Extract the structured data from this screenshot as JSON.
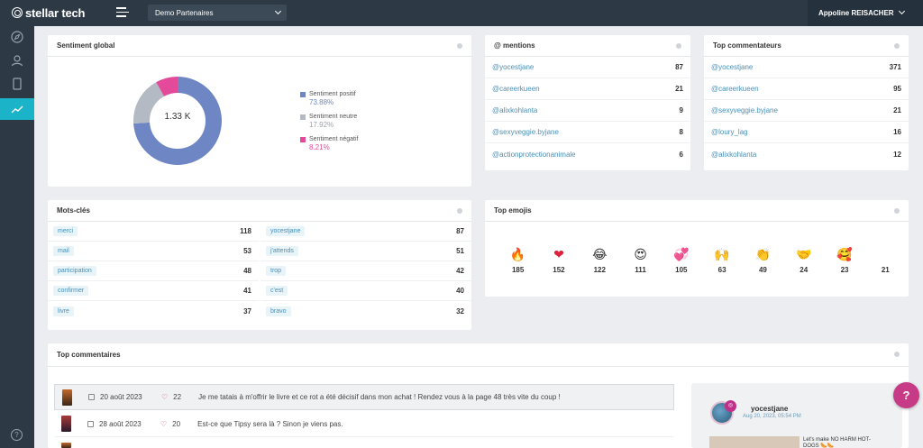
{
  "header": {
    "brand": "stellar tech",
    "project_select": "Demo Partenaires",
    "user_name": "Appoline REISACHER"
  },
  "sidebar": {
    "items": [
      {
        "icon": "compass-icon"
      },
      {
        "icon": "user-icon"
      },
      {
        "icon": "tablet-icon"
      },
      {
        "icon": "trend-icon",
        "active": true
      }
    ],
    "help": "?"
  },
  "sentiment": {
    "title": "Sentiment global",
    "total": "1.33 K",
    "items": [
      {
        "label": "Sentiment positif",
        "value": "73.88%",
        "color": "#6f86c4",
        "fraction": 0.7388
      },
      {
        "label": "Sentiment neutre",
        "value": "17.92%",
        "color": "#b3bac4",
        "fraction": 0.1792
      },
      {
        "label": "Sentiment négatif",
        "value": "8.21%",
        "color": "#e44a9a",
        "fraction": 0.0821
      }
    ]
  },
  "mentions": {
    "title": "@ mentions",
    "rows": [
      {
        "label": "@yocestjane",
        "value": "87"
      },
      {
        "label": "@careerkueen",
        "value": "21"
      },
      {
        "label": "@alixkohlanta",
        "value": "9"
      },
      {
        "label": "@sexyveggie.byjane",
        "value": "8"
      },
      {
        "label": "@actionprotectionanimale",
        "value": "6"
      }
    ]
  },
  "commentateurs": {
    "title": "Top commentateurs",
    "rows": [
      {
        "label": "@yocestjane",
        "value": "371"
      },
      {
        "label": "@careerkueen",
        "value": "95"
      },
      {
        "label": "@sexyveggie.byjane",
        "value": "21"
      },
      {
        "label": "@loury_lag",
        "value": "16"
      },
      {
        "label": "@alixkohlanta",
        "value": "12"
      }
    ]
  },
  "keywords": {
    "title": "Mots-clés",
    "left": [
      {
        "label": "merci",
        "value": "118"
      },
      {
        "label": "mail",
        "value": "53"
      },
      {
        "label": "participation",
        "value": "48"
      },
      {
        "label": "confirmer",
        "value": "41"
      },
      {
        "label": "livre",
        "value": "37"
      }
    ],
    "right": [
      {
        "label": "yocestjane",
        "value": "87"
      },
      {
        "label": "j'attends",
        "value": "51"
      },
      {
        "label": "trop",
        "value": "42"
      },
      {
        "label": "c'est",
        "value": "40"
      },
      {
        "label": "bravo",
        "value": "32"
      }
    ]
  },
  "emojis": {
    "title": "Top emojis",
    "items": [
      {
        "emoji": "🔥",
        "count": "185"
      },
      {
        "emoji": "❤",
        "count": "152"
      },
      {
        "emoji": "😂",
        "count": "122"
      },
      {
        "emoji": "😍",
        "count": "111"
      },
      {
        "emoji": "💞",
        "count": "105"
      },
      {
        "emoji": "🙌",
        "count": "63"
      },
      {
        "emoji": "👏",
        "count": "49"
      },
      {
        "emoji": "🤝",
        "count": "24"
      },
      {
        "emoji": "🥰",
        "count": "23"
      },
      {
        "emoji": "",
        "count": "21"
      }
    ]
  },
  "comments": {
    "title": "Top commentaires",
    "rows": [
      {
        "date": "20 août 2023",
        "likes": "22",
        "text": "Je me tatais à m'offrir le livre et ce rot a été décisif dans mon achat ! Rendez vous à la page 48 très vite du coup !"
      },
      {
        "date": "28 août 2023",
        "likes": "20",
        "text": "Est-ce que Tipsy sera là ? Sinon je viens pas."
      }
    ]
  },
  "preview": {
    "name": "yocestjane",
    "time": "Aug 20, 2023, 05:54 PM",
    "text": "Let's make NO HARM HOT-DOGS 🌭🌭"
  },
  "help_fab": "?"
}
